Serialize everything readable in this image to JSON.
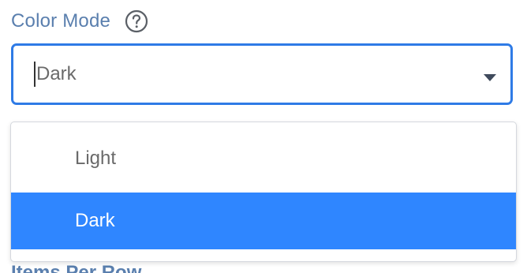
{
  "field": {
    "label": "Color Mode",
    "help_icon": "question-circle-icon",
    "select": {
      "value": "Dark",
      "dropdown_icon": "chevron-down-icon",
      "border_color": "#2f7be6"
    }
  },
  "dropdown": {
    "options": [
      {
        "label": "Light",
        "selected": false
      },
      {
        "label": "Dark",
        "selected": true
      }
    ],
    "selected_bg": "#2f86ff"
  },
  "next_field": {
    "label": "Items Per Row"
  },
  "colors": {
    "label_text": "#5a7fae",
    "value_text": "#6a6a6a"
  }
}
